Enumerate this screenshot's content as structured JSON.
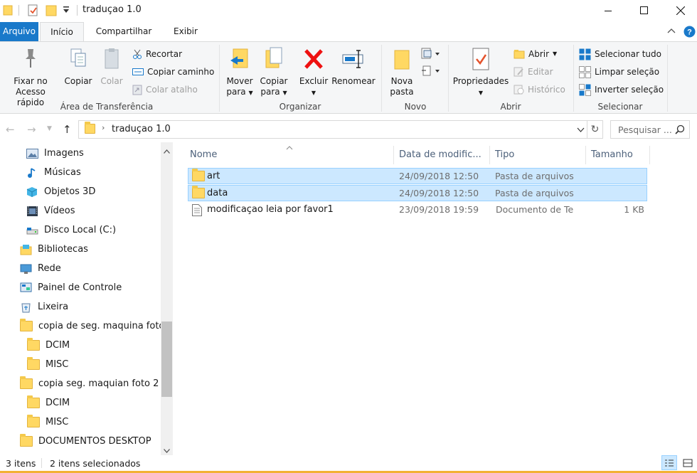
{
  "window": {
    "title": "traduçao 1.0",
    "min_icon": "minimize-icon",
    "max_icon": "maximize-icon",
    "close_icon": "close-icon"
  },
  "tabs": [
    {
      "label": "Arquivo"
    },
    {
      "label": "Início"
    },
    {
      "label": "Compartilhar"
    },
    {
      "label": "Exibir"
    }
  ],
  "ribbon": {
    "clipboard": {
      "group_label": "Área de Transferência",
      "pin_line1": "Fixar no",
      "pin_line2": "Acesso rápido",
      "copy": "Copiar",
      "paste": "Colar",
      "cut": "Recortar",
      "copy_path": "Copiar caminho",
      "paste_shortcut": "Colar atalho"
    },
    "organize": {
      "group_label": "Organizar",
      "move_line1": "Mover",
      "move_line2": "para",
      "copyto_line1": "Copiar",
      "copyto_line2": "para",
      "delete": "Excluir",
      "rename": "Renomear"
    },
    "new": {
      "group_label": "Novo",
      "newfolder_line1": "Nova",
      "newfolder_line2": "pasta"
    },
    "open": {
      "group_label": "Abrir",
      "properties": "Propriedades",
      "open": "Abrir",
      "edit": "Editar",
      "history": "Histórico"
    },
    "select": {
      "group_label": "Selecionar",
      "select_all": "Selecionar tudo",
      "select_none": "Limpar seleção",
      "invert": "Inverter seleção"
    }
  },
  "address": {
    "path": "traduçao 1.0",
    "search_placeholder": "Pesquisar ..."
  },
  "nav": {
    "items": [
      {
        "label": "Imagens",
        "icon": "pictures-icon"
      },
      {
        "label": "Músicas",
        "icon": "music-icon"
      },
      {
        "label": "Objetos 3D",
        "icon": "objects-3d-icon"
      },
      {
        "label": "Vídeos",
        "icon": "videos-icon"
      },
      {
        "label": "Disco Local (C:)",
        "icon": "drive-icon"
      },
      {
        "label": "Bibliotecas",
        "icon": "libraries-icon"
      },
      {
        "label": "Rede",
        "icon": "network-icon"
      },
      {
        "label": "Painel de Controle",
        "icon": "control-panel-icon"
      },
      {
        "label": "Lixeira",
        "icon": "recycle-bin-icon"
      },
      {
        "label": "copia de seg. maquina fotog",
        "icon": "folder-icon"
      },
      {
        "label": "DCIM",
        "icon": "folder-icon"
      },
      {
        "label": "MISC",
        "icon": "folder-icon"
      },
      {
        "label": "copia seg. maquian foto 2",
        "icon": "folder-icon"
      },
      {
        "label": "DCIM",
        "icon": "folder-icon"
      },
      {
        "label": "MISC",
        "icon": "folder-icon"
      },
      {
        "label": "DOCUMENTOS DESKTOP",
        "icon": "folder-icon"
      }
    ]
  },
  "columns": {
    "name": "Nome",
    "date": "Data de modific...",
    "type": "Tipo",
    "size": "Tamanho"
  },
  "files": [
    {
      "name": "art",
      "date": "24/09/2018 12:50",
      "type": "Pasta de arquivos",
      "size": "",
      "selected": true,
      "icon": "folder-icon"
    },
    {
      "name": "data",
      "date": "24/09/2018 12:50",
      "type": "Pasta de arquivos",
      "size": "",
      "selected": true,
      "icon": "folder-icon"
    },
    {
      "name": "modificaçao leia por favor1",
      "date": "23/09/2018 19:59",
      "type": "Documento de Te",
      "size": "1 KB",
      "selected": false,
      "icon": "text-document-icon"
    }
  ],
  "status": {
    "item_count": "3 itens",
    "selected_count": "2 itens selecionados"
  },
  "colors": {
    "accent": "#1979ca",
    "selection": "#cce8ff",
    "selection_border": "#99d1ff"
  }
}
